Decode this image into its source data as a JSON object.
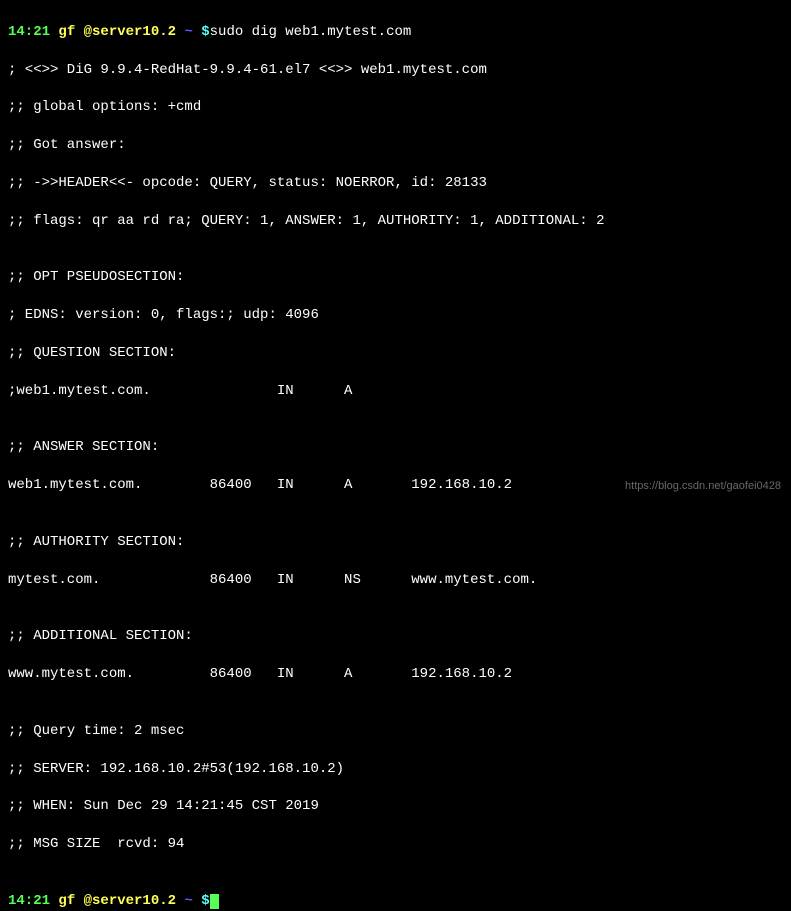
{
  "prompt1": {
    "time": "14:21",
    "user_host": " gf @server10.2 ",
    "cwd": "~ ",
    "dollar": "$",
    "command": "sudo dig web1.mytest.com"
  },
  "output": {
    "blank1": "",
    "header1": "; <<>> DiG 9.9.4-RedHat-9.9.4-61.el7 <<>> web1.mytest.com",
    "header2": ";; global options: +cmd",
    "header3": ";; Got answer:",
    "header4": ";; ->>HEADER<<- opcode: QUERY, status: NOERROR, id: 28133",
    "header5": ";; flags: qr aa rd ra; QUERY: 1, ANSWER: 1, AUTHORITY: 1, ADDITIONAL: 2",
    "blank2": "",
    "opt1": ";; OPT PSEUDOSECTION:",
    "opt2": "; EDNS: version: 0, flags:; udp: 4096",
    "q1": ";; QUESTION SECTION:",
    "q2": ";web1.mytest.com.               IN      A",
    "blank3": "",
    "ans1": ";; ANSWER SECTION:",
    "ans2": "web1.mytest.com.        86400   IN      A       192.168.10.2",
    "blank4": "",
    "auth1": ";; AUTHORITY SECTION:",
    "auth2": "mytest.com.             86400   IN      NS      www.mytest.com.",
    "blank5": "",
    "add1": ";; ADDITIONAL SECTION:",
    "add2": "www.mytest.com.         86400   IN      A       192.168.10.2",
    "blank6": "",
    "foot1": ";; Query time: 2 msec",
    "foot2": ";; SERVER: 192.168.10.2#53(192.168.10.2)",
    "foot3": ";; WHEN: Sun Dec 29 14:21:45 CST 2019",
    "foot4": ";; MSG SIZE  rcvd: 94",
    "blank7": ""
  },
  "prompt2": {
    "time": "14:21",
    "user_host": " gf @server10.2 ",
    "cwd": "~ ",
    "dollar": "$"
  },
  "watermark": "https://blog.csdn.net/gaofei0428"
}
